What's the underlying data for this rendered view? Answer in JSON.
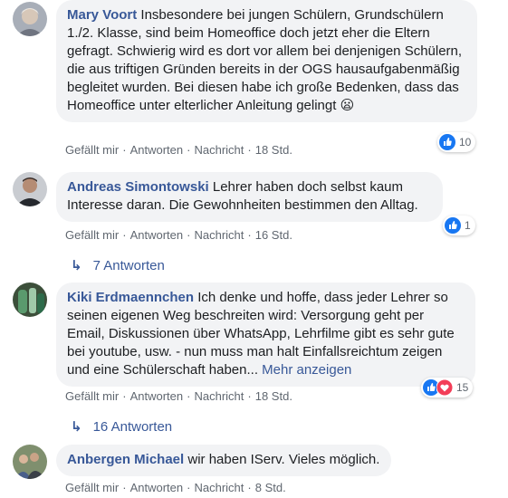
{
  "comments": [
    {
      "author": "Mary Voort",
      "text": "Insbesondere bei jungen Schülern, Grundschülern 1./2. Klasse, sind beim Homeoffice doch jetzt eher die Eltern gefragt. Schwierig wird es dort vor allem bei denjenigen Schülern, die aus triftigen Gründen bereits in der OGS hausaufgabenmäßig begleitet wurden. Bei diesen habe ich große Bedenken, dass das Homeoffice unter elterlicher Anleitung gelingt 😦",
      "like": "Gefällt mir",
      "reply": "Antworten",
      "message": "Nachricht",
      "time": "18 Std.",
      "reaction_count": "10"
    },
    {
      "author": "Andreas Simontowski",
      "text": "Lehrer haben doch selbst kaum Interesse daran. Die Gewohnheiten bestimmen den Alltag.",
      "like": "Gefällt mir",
      "reply": "Antworten",
      "message": "Nachricht",
      "time": "16 Std.",
      "reaction_count": "1",
      "replies_label": "7 Antworten"
    },
    {
      "author": "Kiki Erdmaennchen",
      "text": "Ich denke und hoffe, dass jeder Lehrer so seinen eigenen Weg beschreiten wird: Versorgung geht per Email, Diskussionen über WhatsApp, Lehrfilme gibt es sehr gute bei youtube, usw. - nun muss man halt Einfallsreichtum zeigen und eine Schülerschaft haben...",
      "more": "Mehr anzeigen",
      "like": "Gefällt mir",
      "reply": "Antworten",
      "message": "Nachricht",
      "time": "18 Std.",
      "reaction_count": "15",
      "replies_label": "16 Antworten"
    },
    {
      "author": "Anbergen Michael",
      "text": "wir haben IServ. Vieles möglich.",
      "like": "Gefällt mir",
      "reply": "Antworten",
      "message": "Nachricht",
      "time": "8 Std."
    }
  ],
  "colors": {
    "name": "#385898",
    "bubble": "#f2f3f5",
    "meta": "#606770",
    "like_blue": "#1877f2",
    "love_red": "#f33e58"
  }
}
